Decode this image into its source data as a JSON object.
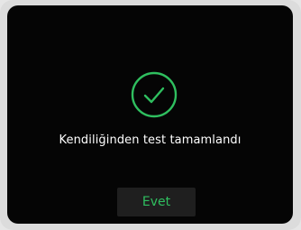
{
  "dialog": {
    "icon": "checkmark-circle-icon",
    "message": "Kendiliğinden test tamamlandı",
    "confirm_label": "Evet"
  },
  "colors": {
    "screen_background": "#050505",
    "accent": "#2fbf5f",
    "text": "#ffffff",
    "button_background": "#1f1f1f",
    "frame": "#dcdcdc"
  }
}
